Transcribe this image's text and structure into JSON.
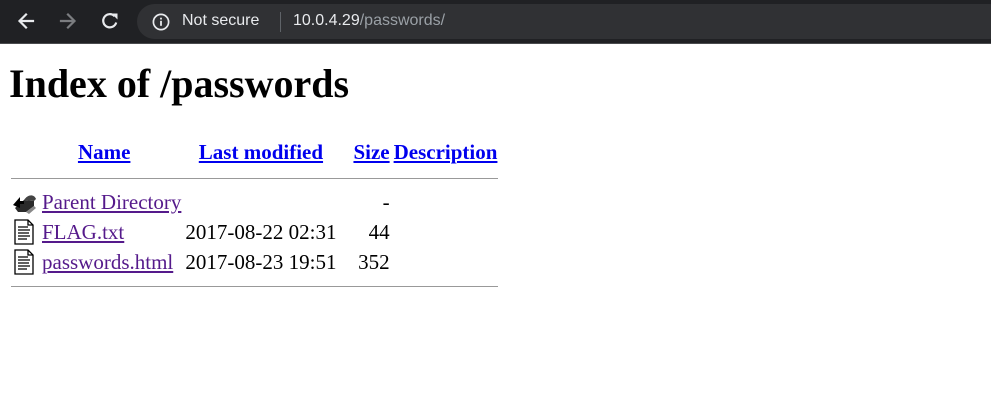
{
  "browser": {
    "security_label": "Not secure",
    "url_host": "10.0.4.29",
    "url_path": "/passwords/",
    "icons": {
      "back": "arrow-left-icon",
      "forward": "arrow-right-icon",
      "reload": "reload-icon",
      "info": "info-circle-icon"
    }
  },
  "page": {
    "title": "Index of /passwords",
    "columns": {
      "name": "Name",
      "last_modified": "Last modified",
      "size": "Size",
      "description": "Description"
    },
    "entries": [
      {
        "icon": "back-folder-icon",
        "name": "Parent Directory",
        "modified": "",
        "size": "-",
        "description": ""
      },
      {
        "icon": "text-file-icon",
        "name": "FLAG.txt",
        "modified": "2017-08-22 02:31",
        "size": "44",
        "description": ""
      },
      {
        "icon": "text-file-icon",
        "name": "passwords.html",
        "modified": "2017-08-23 19:51",
        "size": "352",
        "description": ""
      }
    ]
  },
  "colors": {
    "chrome_bg": "#202124",
    "omnibox_bg": "#303134",
    "link_header": "#0000ee",
    "link_visited": "#551a8b"
  }
}
